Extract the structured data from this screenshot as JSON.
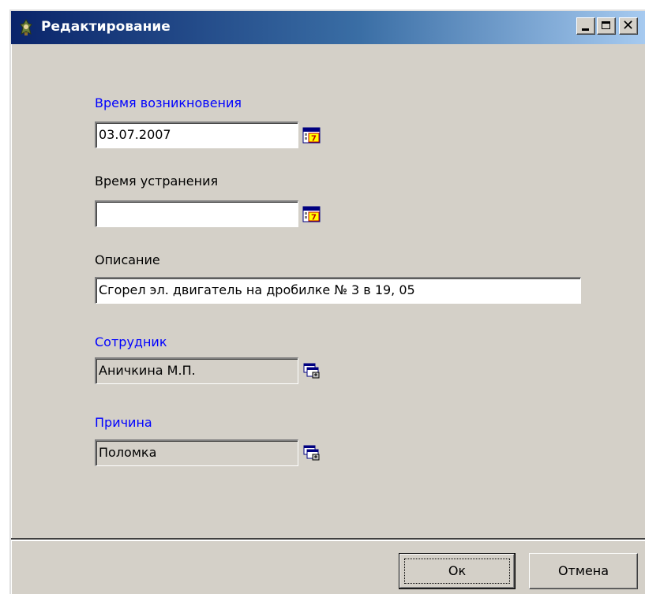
{
  "window": {
    "title": "Редактирование",
    "icon": "app-icon",
    "controls": {
      "minimize": "_",
      "maximize": "□",
      "close": "×"
    }
  },
  "form": {
    "occurrence": {
      "label": "Время возникновения",
      "value": "03.07.2007",
      "button_icon": "calendar-icon"
    },
    "resolution": {
      "label": "Время устранения",
      "value": "",
      "button_icon": "calendar-icon"
    },
    "description": {
      "label": "Описание",
      "value": "Сгорел эл. двигатель  на дробилке  № 3        в  19, 05"
    },
    "employee": {
      "label": "Сотрудник",
      "value": "Аничкина М.П.",
      "button_icon": "lookup-icon"
    },
    "reason": {
      "label": "Причина",
      "value": "Поломка",
      "button_icon": "lookup-icon"
    }
  },
  "buttons": {
    "ok": "Ок",
    "cancel": "Отмена"
  },
  "colors": {
    "dialog_bg": "#d4d0c8",
    "title_gradient_start": "#0a246a",
    "title_gradient_end": "#a6caf0",
    "required_label": "#0000ff"
  }
}
